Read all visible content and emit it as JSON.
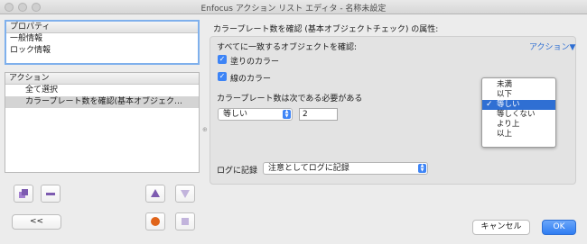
{
  "window": {
    "title": "Enfocus アクション リスト エディタ - 名称未設定"
  },
  "properties_list": {
    "header": "プロパティ",
    "items": [
      "一般情報",
      "ロック情報"
    ]
  },
  "actions_list": {
    "header": "アクション",
    "items": [
      "全て選択",
      "カラープレート数を確認(基本オブジェク…"
    ],
    "selected_index": 1
  },
  "left_buttons": {
    "collapse_label": "<<"
  },
  "panel": {
    "heading": "カラープレート数を確認 (基本オブジェクトチェック) の属性:",
    "match_label": "すべてに一致するオブジェクトを確認:",
    "action_link": "アクション▼",
    "fill_color_label": "塗りのカラー",
    "stroke_color_label": "線のカラー",
    "plate_count_label": "カラープレート数は次である必要がある",
    "comparison_value": "等しい",
    "count_value": "2",
    "log_label": "ログに記録",
    "log_value": "注意としてログに記録"
  },
  "comparison_menu": {
    "options": [
      "未満",
      "以下",
      "等しい",
      "等しくない",
      "より上",
      "以上"
    ],
    "selected_index": 2
  },
  "footer": {
    "cancel_label": "キャンセル",
    "ok_label": "OK"
  },
  "colors": {
    "accent": "#3d84f6",
    "menu_highlight": "#2f6fd3",
    "up_arrow": "#7d5bb0",
    "record_button": "#e0641a"
  }
}
